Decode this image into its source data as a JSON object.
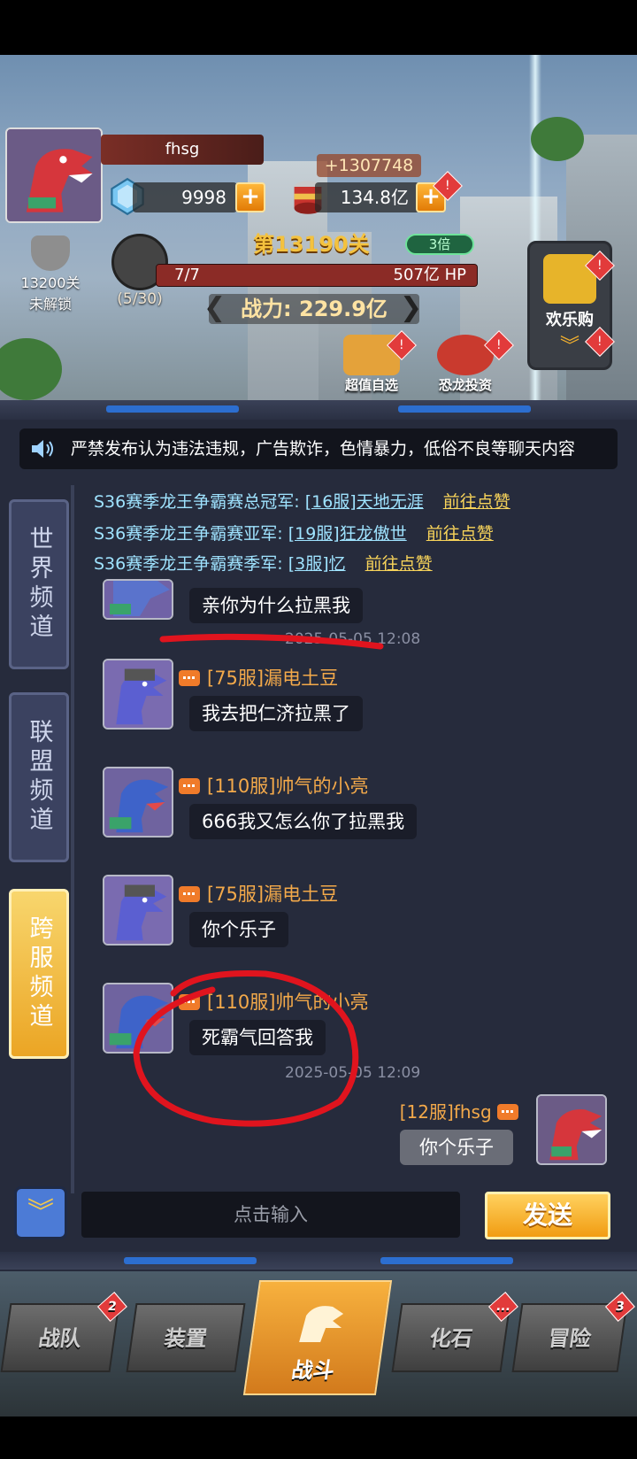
{
  "player": {
    "name": "fhsg",
    "gems": "9998",
    "gold": "134.8亿",
    "gold_gain": "+1307748"
  },
  "stage": {
    "title": "第13190关",
    "speed": "3倍",
    "locked_stage": "13200关",
    "locked_label": "未解锁",
    "boss_count": "(5/30)",
    "hp_progress": "7/7",
    "hp_fraction": 1.0,
    "hp_value": "507亿 HP",
    "power": "战力: 229.9亿"
  },
  "side_buttons": {
    "happy_buy": "欢乐购",
    "super_value": "超值自选",
    "dino_rank": "恐龙投资"
  },
  "chat": {
    "notice": "严禁发布认为违法违规，广告欺诈，色情暴力，低俗不良等聊天内容",
    "tabs": [
      {
        "label": "世界频道"
      },
      {
        "label": "联盟频道"
      },
      {
        "label": "跨服频道"
      }
    ],
    "announcements": [
      {
        "prefix": "S36赛季龙王争霸赛总冠军:",
        "player": "[16服]天地无涯",
        "action": "前往点赞"
      },
      {
        "prefix": "S36赛季龙王争霸赛亚军:",
        "player": "[19服]狂龙傲世",
        "action": "前往点赞"
      },
      {
        "prefix": "S36赛季龙王争霸赛季军:",
        "player": "[3服]忆",
        "action": "前往点赞"
      }
    ],
    "messages": [
      {
        "name": "",
        "text": "亲你为什么拉黑我",
        "time": "2025-05-05 12:08"
      },
      {
        "name": "[75服]漏电土豆",
        "text": "我去把仁济拉黑了",
        "time": ""
      },
      {
        "name": "[110服]帅气的小亮",
        "text": "666我又怎么你了拉黑我",
        "time": ""
      },
      {
        "name": "[75服]漏电土豆",
        "text": "你个乐子",
        "time": ""
      },
      {
        "name": "[110服]帅气的小亮",
        "text": "死霸气回答我",
        "time": "2025-05-05 12:09"
      }
    ],
    "self_message": {
      "name": "[12服]fhsg",
      "text": "你个乐子"
    },
    "input_placeholder": "点击输入",
    "send_label": "发送"
  },
  "nav": {
    "items": [
      {
        "label": "战队",
        "badge": "2"
      },
      {
        "label": "装置",
        "badge": ""
      },
      {
        "label": "战斗",
        "badge": ""
      },
      {
        "label": "化石",
        "badge": "..."
      },
      {
        "label": "冒险",
        "badge": "3"
      }
    ]
  },
  "colors": {
    "accent_orange": "#f3a94a",
    "send_button": "#f19c12",
    "panel_bg": "#262b3c",
    "annotation_red": "#e0141e"
  }
}
